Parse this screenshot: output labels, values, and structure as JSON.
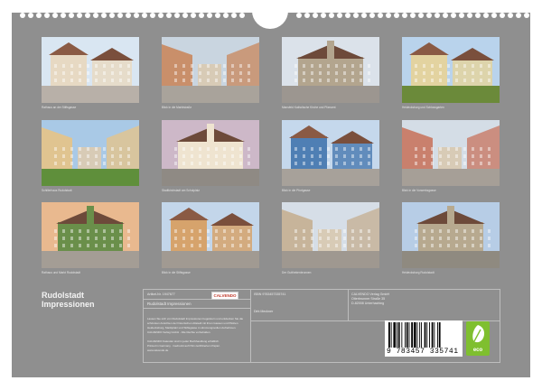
{
  "calendar": {
    "title_line1": "Rudolstadt",
    "title_line2": "Impressionen"
  },
  "photos": [
    {
      "caption": "Rathaus an der Stiftsgasse",
      "sky": "#d9e6f2",
      "bldg": "#e7d9c3",
      "ground": "#b8b0a8"
    },
    {
      "caption": "Blick in die Marktstraße",
      "sky": "#c9d5e0",
      "bldg": "#c98f6a",
      "ground": "#a9a39b"
    },
    {
      "caption": "Mansfeld Katholische Kirche und Pfarramt",
      "sky": "#dbe2ea",
      "bldg": "#b3a58e",
      "ground": "#9c9690"
    },
    {
      "caption": "Heidecksburg und Schlossgarten",
      "sky": "#b9d3ec",
      "bldg": "#e3d3a0",
      "ground": "#6b8a3a"
    },
    {
      "caption": "Schillerhaus Rudolstadt",
      "sky": "#a9c9e6",
      "bldg": "#e0c490",
      "ground": "#5f8f3b"
    },
    {
      "caption": "Stadtkirchstadt am Schulplatz",
      "sky": "#cdb8c8",
      "bldg": "#efe4d0",
      "ground": "#8f8a84"
    },
    {
      "caption": "Blick in die Pfortgasse",
      "sky": "#c5d8ec",
      "bldg": "#4f7fb4",
      "ground": "#a7a19a"
    },
    {
      "caption": "Blick in die Vorwerksgasse",
      "sky": "#d4dde6",
      "bldg": "#c9806d",
      "ground": "#a69f97"
    },
    {
      "caption": "Rathaus und Markt Rudolstadt",
      "sky": "#e9b98f",
      "bldg": "#6a8f4a",
      "ground": "#a49d95"
    },
    {
      "caption": "Blick in die Stiftsgasse",
      "sky": "#c3d6ea",
      "bldg": "#d6a36c",
      "ground": "#a19a92"
    },
    {
      "caption": "Der Gutthekenbrunnen",
      "sky": "#d6dee7",
      "bldg": "#c7b49a",
      "ground": "#9f9890"
    },
    {
      "caption": "Heidecksburg Rudolstadt",
      "sky": "#b7cde6",
      "bldg": "#b7a98f",
      "ground": "#8f8a80"
    }
  ],
  "info": {
    "article_label": "Artikel-Nr. 1947677",
    "product_title": "Rudolstadt Impressionen",
    "isbn": "ISBN 9783457335741",
    "author": "Dirk Meckner",
    "publisher_line1": "CALVENDO Verlag GmbH",
    "publisher_line2": "Otterbrunner Straße 35",
    "publisher_line3": "D-82008 Unterhaching",
    "logo": "CALVENDO",
    "desc_lines": [
      "Lassen Sie sich von Rudolstadt Impressionen begeistern und entdecken Sie die",
      "schönsten Ansichten der historischen Altstadt mit ihren Gassen und Plätzen.",
      "Heidecksburg, Marktplatz und Stiftsgasse in stimmungsvollen Aufnahmen.",
      "CALVENDO Verlag GmbH · Alle Rechte vorbehalten.",
      "",
      "CALVENDO Kalender sind in jeder Buchhandlung erhältlich.",
      "Printed in Germany · Gedruckt auf FSC-zertifiziertem Papier.",
      "www.calvendo.de"
    ],
    "barcode": "9 783457 335741",
    "eco_label": "eco"
  }
}
